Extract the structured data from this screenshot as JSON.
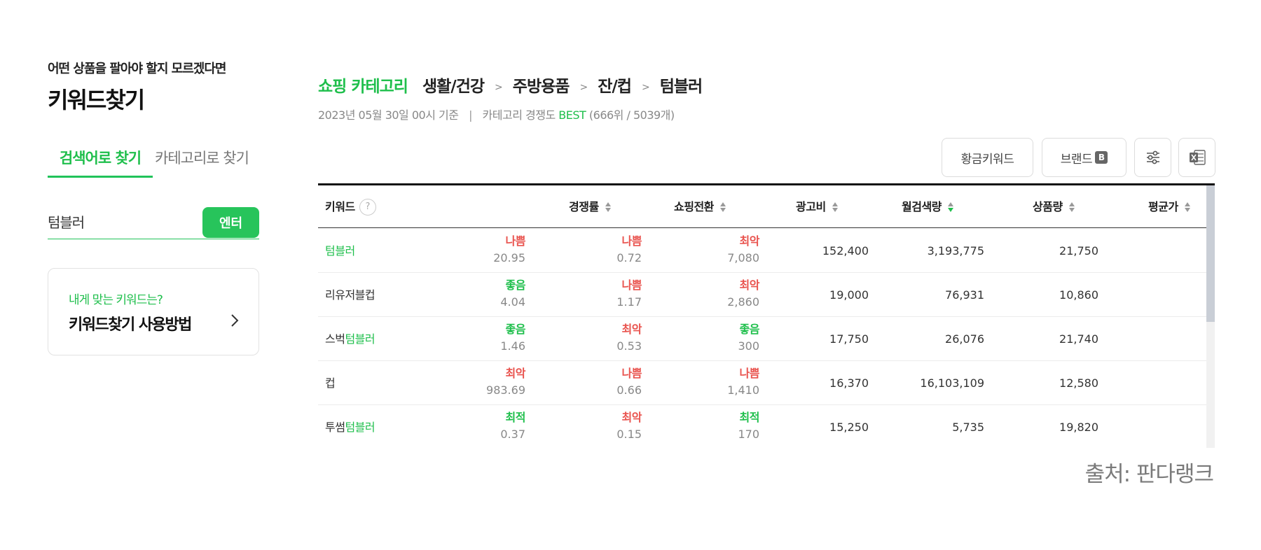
{
  "colors": {
    "accent": "#1fbf4c",
    "bad": "#e9544f",
    "enter_button": "#27c45b"
  },
  "left": {
    "tagline": "어떤 상품을 팔아야 할지 모르겠다면",
    "title": "키워드찾기",
    "tabs": {
      "search": "검색어로 찾기",
      "category": "카테고리로 찾기"
    },
    "search": {
      "value": "텀블러",
      "enter_label": "엔터"
    },
    "guide": {
      "sub": "내게 맞는 키워드는?",
      "main": "키워드찾기 사용방법",
      "icon": "chevron-right-icon"
    }
  },
  "breadcrumb": {
    "root": "쇼핑 카테고리",
    "items": [
      "생활/건강",
      "주방용품",
      "잔/컵",
      "텀블러"
    ],
    "separator": ">"
  },
  "meta": {
    "date": "2023년 05월 30일 00시 기준",
    "divider": "|",
    "competition_label": "카테고리 경쟁도",
    "competition_grade": "BEST",
    "competition_rank": "(666위 / 5039개)"
  },
  "toolbar": {
    "golden_keyword": "황금키워드",
    "brand": "브랜드",
    "brand_badge": "B",
    "filter_icon": "sliders-icon",
    "excel_icon": "excel-icon"
  },
  "table": {
    "headers": {
      "keyword": "키워드",
      "help": "?",
      "competition": "경쟁률",
      "conversion": "쇼핑전환",
      "ad_cost": "광고비",
      "monthly_search": "월검색량",
      "product_count": "상품량",
      "avg_price": "평균가"
    },
    "rows": [
      {
        "kw_prefix": "",
        "kw_highlight": "텀블러",
        "comp_label": "나쁨",
        "comp_value": "20.95",
        "conv_label": "나쁨",
        "conv_value": "0.72",
        "ad_label": "최악",
        "ad_value": "7,080",
        "search": "152,400",
        "products": "3,193,775",
        "price": "21,750"
      },
      {
        "kw_prefix": "리유저블컵",
        "kw_highlight": "",
        "comp_label": "좋음",
        "comp_value": "4.04",
        "conv_label": "나쁨",
        "conv_value": "1.17",
        "ad_label": "최악",
        "ad_value": "2,860",
        "search": "19,000",
        "products": "76,931",
        "price": "10,860"
      },
      {
        "kw_prefix": "스벅",
        "kw_highlight": "텀블러",
        "comp_label": "좋음",
        "comp_value": "1.46",
        "conv_label": "최악",
        "conv_value": "0.53",
        "ad_label": "좋음",
        "ad_value": "300",
        "search": "17,750",
        "products": "26,076",
        "price": "21,740"
      },
      {
        "kw_prefix": "컵",
        "kw_highlight": "",
        "comp_label": "최악",
        "comp_value": "983.69",
        "conv_label": "나쁨",
        "conv_value": "0.66",
        "ad_label": "나쁨",
        "ad_value": "1,410",
        "search": "16,370",
        "products": "16,103,109",
        "price": "12,580"
      },
      {
        "kw_prefix": "투썸",
        "kw_highlight": "텀블러",
        "comp_label": "최적",
        "comp_value": "0.37",
        "conv_label": "최악",
        "conv_value": "0.15",
        "ad_label": "최적",
        "ad_value": "170",
        "search": "15,250",
        "products": "5,735",
        "price": "19,820"
      }
    ]
  },
  "source": "출처: 판다랭크"
}
